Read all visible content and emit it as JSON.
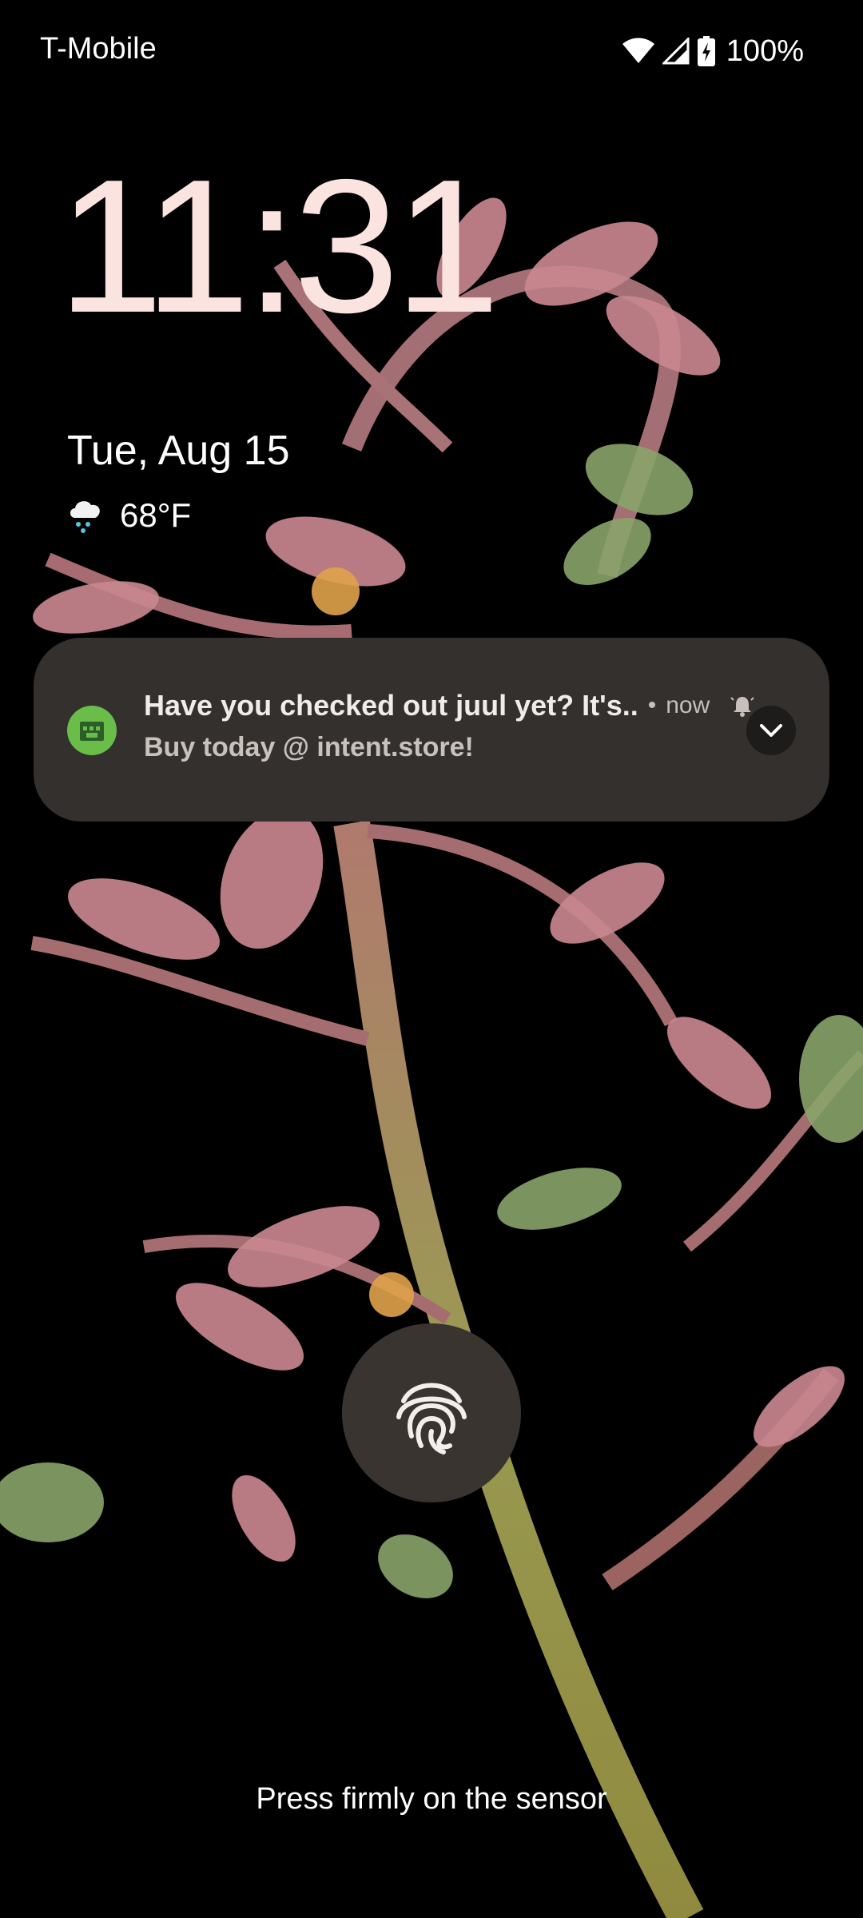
{
  "status_bar": {
    "carrier": "T-Mobile",
    "battery": "100%",
    "icons": [
      "wifi-icon",
      "cell-signal-icon",
      "battery-charging-icon"
    ]
  },
  "lockscreen": {
    "time": "11:31",
    "date": "Tue, Aug 15",
    "weather": {
      "icon": "rain-cloud-icon",
      "temp": "68°F"
    }
  },
  "notification": {
    "app_icon": "app-icon",
    "title": "Have you checked out juul yet? It's..",
    "separator": "•",
    "time": "now",
    "alert_icon": "bell-icon",
    "body": "Buy today @ intent.store!",
    "expand_icon": "chevron-down-icon"
  },
  "unlock": {
    "fingerprint_icon": "fingerprint-icon",
    "hint": "Press firmly on the sensor"
  },
  "colors": {
    "clock": "#fbe3e0",
    "notification_bg": "#33302d",
    "app_icon_bg": "#6bbd4a",
    "fingerprint_bg": "#3a3431"
  }
}
